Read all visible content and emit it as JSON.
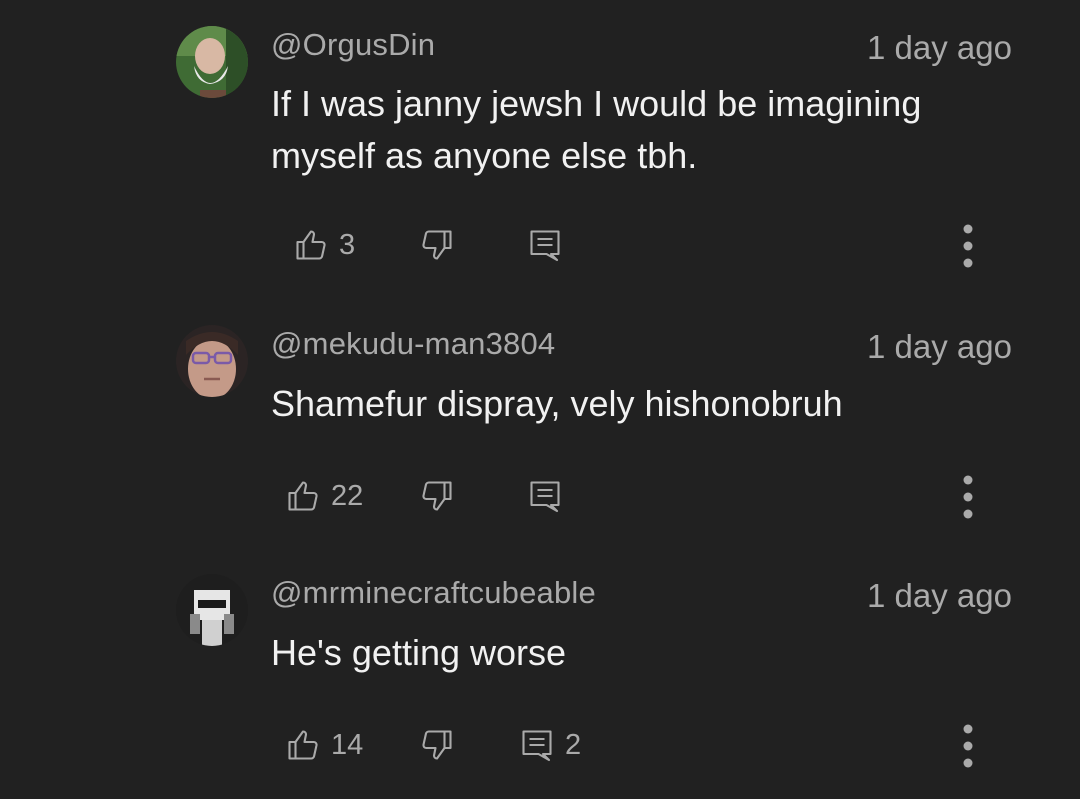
{
  "comments": [
    {
      "author": "@OrgusDin",
      "time": "1 day ago",
      "text": "If I was janny jewsh I would be imagining myself as anyone else tbh.",
      "likes": "3",
      "replies": ""
    },
    {
      "author": "@mekudu-man3804",
      "time": "1 day ago",
      "text": "Shamefur dispray, vely hishonobruh",
      "likes": "22",
      "replies": ""
    },
    {
      "author": "@mrminecraftcubeable",
      "time": "1 day ago",
      "text": "He's getting worse",
      "likes": "14",
      "replies": "2"
    }
  ],
  "icons": {
    "like": "thumbs-up-icon",
    "dislike": "thumbs-down-icon",
    "reply": "reply-comment-icon",
    "more": "more-vertical-icon"
  },
  "colors": {
    "background": "#212121",
    "text_primary": "#f1f1f1",
    "text_secondary": "#aaaaaa"
  }
}
